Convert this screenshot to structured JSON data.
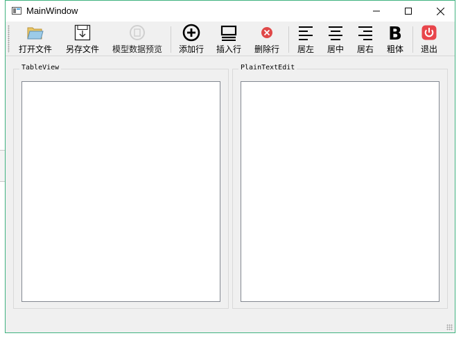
{
  "window": {
    "title": "MainWindow"
  },
  "toolbar": {
    "open": "打开文件",
    "save_as": "另存文件",
    "preview": "模型数据预览",
    "add_row": "添加行",
    "insert_row": "插入行",
    "delete_row": "删除行",
    "align_left": "居左",
    "align_center": "居中",
    "align_right": "居右",
    "bold": "粗体",
    "exit": "退出"
  },
  "groups": {
    "table": "TableView",
    "text": "PlainTextEdit"
  },
  "colors": {
    "accent_border": "#3fb27f",
    "delete_red": "#e04848",
    "exit_red": "#e8454b"
  }
}
